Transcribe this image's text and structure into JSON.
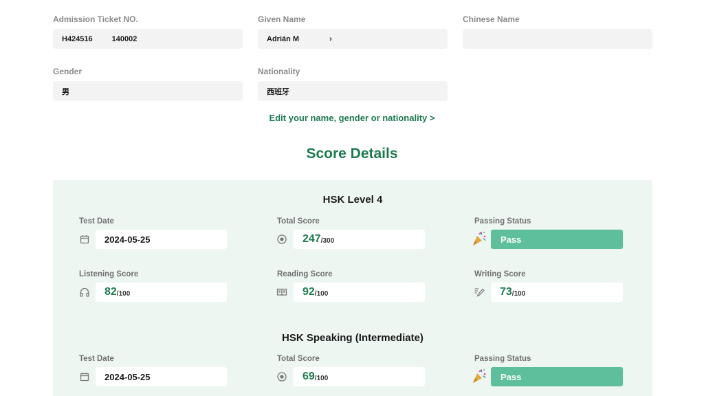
{
  "info": {
    "ticket": {
      "label": "Admission Ticket NO.",
      "value_a": "H424516",
      "value_b": "140002"
    },
    "given_name": {
      "label": "Given Name",
      "value_a": "Adrián M",
      "value_b": "›"
    },
    "chinese_name": {
      "label": "Chinese Name",
      "value": ""
    },
    "gender": {
      "label": "Gender",
      "value": "男"
    },
    "nationality": {
      "label": "Nationality",
      "value": "西班牙"
    }
  },
  "edit_link": "Edit your name, gender or nationality >",
  "section_title": "Score Details",
  "exams": [
    {
      "title": "HSK Level 4",
      "test_date_label": "Test Date",
      "test_date": "2024-05-25",
      "total_label": "Total Score",
      "total": "247",
      "total_max": "/300",
      "passing_label": "Passing Status",
      "passing": "Pass",
      "listening_label": "Listening Score",
      "listening": "82",
      "listening_max": "/100",
      "reading_label": "Reading Score",
      "reading": "92",
      "reading_max": "/100",
      "writing_label": "Writing Score",
      "writing": "73",
      "writing_max": "/100"
    },
    {
      "title": "HSK Speaking (Intermediate)",
      "test_date_label": "Test Date",
      "test_date": "2024-05-25",
      "total_label": "Total Score",
      "total": "69",
      "total_max": "/100",
      "passing_label": "Passing Status",
      "passing": "Pass"
    }
  ],
  "colors": {
    "accent": "#1e7b4f",
    "pass_bg": "#5dbf9b",
    "panel_bg": "#eef6f2",
    "field_bg": "#f3f3f3"
  }
}
